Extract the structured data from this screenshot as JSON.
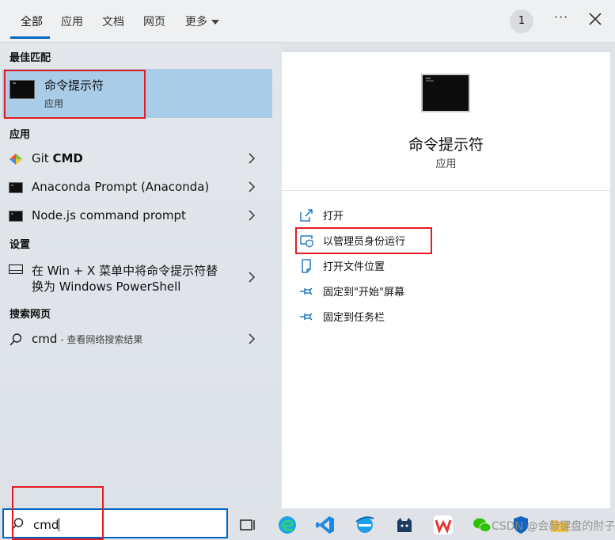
{
  "tabs": [
    {
      "label": "全部"
    },
    {
      "label": "应用"
    },
    {
      "label": "文档"
    },
    {
      "label": "网页"
    },
    {
      "label": "更多"
    }
  ],
  "header": {
    "badge": "1",
    "more_dots": "···"
  },
  "sections": {
    "best_match": "最佳匹配",
    "apps": "应用",
    "settings": "设置",
    "web_search": "搜索网页"
  },
  "best_match": {
    "title": "命令提示符",
    "subtitle": "应用"
  },
  "apps": [
    {
      "label_prefix": "Git ",
      "label_bold": "CMD",
      "icon": "git-diamond-icon"
    },
    {
      "label": "Anaconda Prompt (Anaconda)",
      "icon": "console-icon"
    },
    {
      "label": "Node.js command prompt",
      "icon": "console-icon"
    }
  ],
  "settings": {
    "line1": "在 Win + X 菜单中将命令提示符替",
    "line2": "换为 Windows PowerShell"
  },
  "web_search": {
    "query": "cmd",
    "suffix": " - 查看网络搜索结果"
  },
  "preview": {
    "title": "命令提示符",
    "subtitle": "应用"
  },
  "actions": [
    {
      "label": "打开",
      "icon": "open-icon"
    },
    {
      "label": "以管理员身份运行",
      "icon": "shield-icon"
    },
    {
      "label": "打开文件位置",
      "icon": "file-location-icon"
    },
    {
      "label": "固定到\"开始\"屏幕",
      "icon": "pin-icon"
    },
    {
      "label": "固定到任务栏",
      "icon": "pin-icon"
    }
  ],
  "search": {
    "value": "cmd"
  },
  "taskbar": {
    "watermark": "CSDN @会敲键盘的肘子"
  },
  "colors": {
    "accent": "#0067c0",
    "highlight": "#a9cde9",
    "annotation_red": "#e31b23"
  }
}
